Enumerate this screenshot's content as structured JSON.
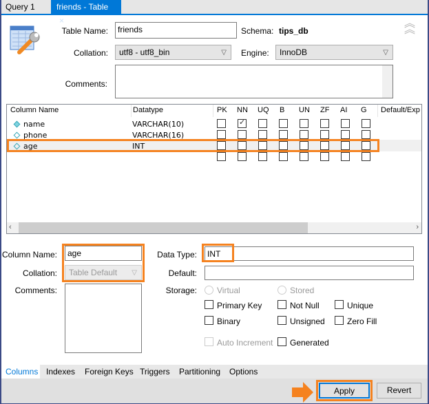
{
  "tabs": [
    {
      "label": "Query 1"
    },
    {
      "label": "friends - Table",
      "close": "×"
    }
  ],
  "table": {
    "name_label": "Table Name:",
    "name": "friends",
    "schema_label": "Schema:",
    "schema": "tips_db",
    "collation_label": "Collation:",
    "collation": "utf8 - utf8_bin",
    "engine_label": "Engine:",
    "engine": "InnoDB",
    "comments_label": "Comments:",
    "comments": ""
  },
  "grid": {
    "headers": [
      "Column Name",
      "Datatype",
      "PK",
      "NN",
      "UQ",
      "B",
      "UN",
      "ZF",
      "AI",
      "G",
      "Default/Exp"
    ],
    "rows": [
      {
        "name": "name",
        "type": "VARCHAR(10)",
        "flags": [
          false,
          true,
          false,
          false,
          false,
          false,
          false,
          false
        ]
      },
      {
        "name": "phone",
        "type": "VARCHAR(16)",
        "flags": [
          false,
          false,
          false,
          false,
          false,
          false,
          false,
          false
        ]
      },
      {
        "name": "age",
        "type": "INT",
        "flags": [
          false,
          false,
          false,
          false,
          false,
          false,
          false,
          false
        ],
        "selected": true
      }
    ]
  },
  "detail": {
    "column_name_label": "Column Name:",
    "column_name": "age",
    "collation_label": "Collation:",
    "collation": "Table Default",
    "comments_label": "Comments:",
    "data_type_label": "Data Type:",
    "data_type": "INT",
    "default_label": "Default:",
    "default": "",
    "storage_label": "Storage:",
    "virtual": "Virtual",
    "stored": "Stored",
    "primary_key": "Primary Key",
    "not_null": "Not Null",
    "unique": "Unique",
    "binary": "Binary",
    "unsigned": "Unsigned",
    "zero_fill": "Zero Fill",
    "auto_increment": "Auto Increment",
    "generated": "Generated"
  },
  "bottom_tabs": [
    "Columns",
    "Indexes",
    "Foreign Keys",
    "Triggers",
    "Partitioning",
    "Options"
  ],
  "buttons": {
    "apply": "Apply",
    "revert": "Revert"
  },
  "colors": {
    "accent": "#0078d7",
    "highlight": "#f5821f"
  }
}
